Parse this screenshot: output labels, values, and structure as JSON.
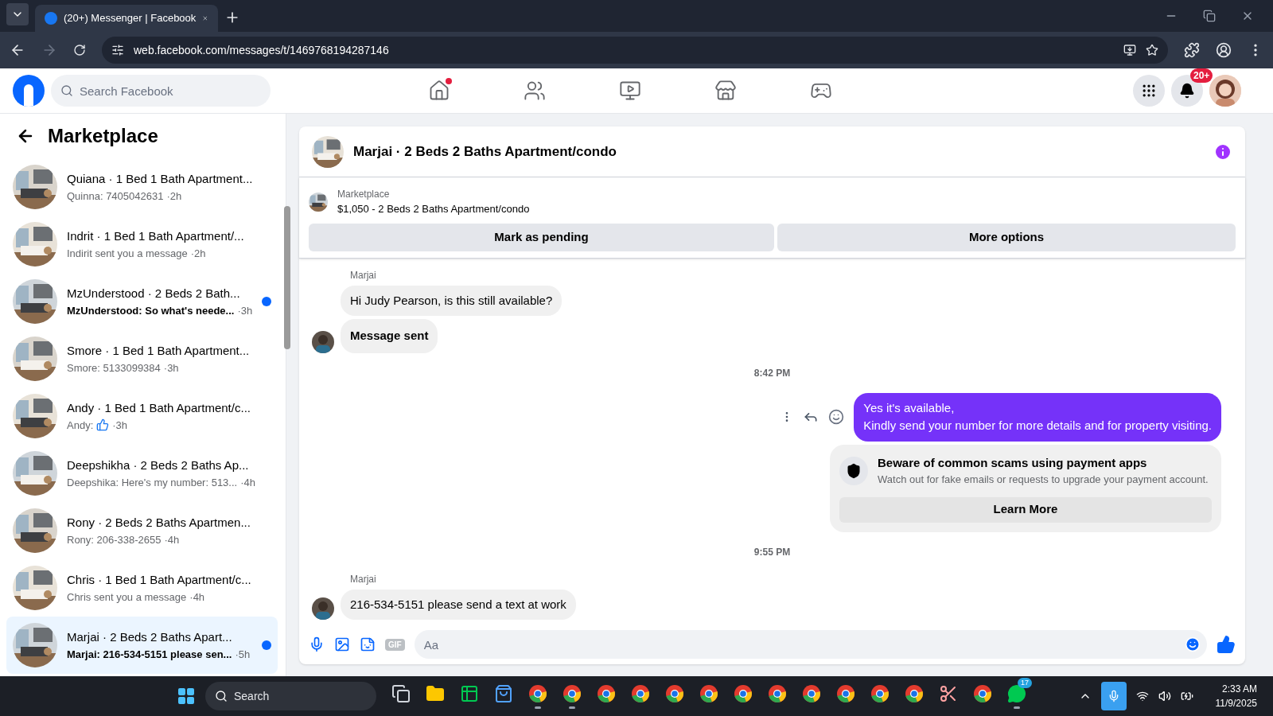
{
  "browser": {
    "tab_title": "(20+) Messenger | Facebook",
    "url": "web.facebook.com/messages/t/1469768194287146"
  },
  "topbar": {
    "search_placeholder": "Search Facebook",
    "nav": [
      {
        "kind": "home",
        "dot": true
      },
      {
        "kind": "friends",
        "dot": false
      },
      {
        "kind": "video",
        "dot": false
      },
      {
        "kind": "marketplace",
        "dot": false
      },
      {
        "kind": "gaming",
        "dot": false
      }
    ],
    "notifications_badge": "20+"
  },
  "sidebar": {
    "title": "Marketplace",
    "conversations": [
      {
        "title": "Quiana · 1 Bed 1 Bath Apartment...",
        "preview": "Quinna: 7405042631",
        "time": "·2h",
        "unread": false,
        "selected": false,
        "like": false
      },
      {
        "title": "Indrit · 1 Bed 1 Bath Apartment/...",
        "preview": "Indirit sent you a message",
        "time": "·2h",
        "unread": false,
        "selected": false,
        "like": false
      },
      {
        "title": "MzUnderstood · 2 Beds 2 Bath...",
        "preview": "MzUnderstood: So what's neede...",
        "time": "·3h",
        "unread": true,
        "selected": false,
        "like": false
      },
      {
        "title": "Smore · 1 Bed 1 Bath Apartment...",
        "preview": "Smore: 5133099384",
        "time": "·3h",
        "unread": false,
        "selected": false,
        "like": false
      },
      {
        "title": "Andy · 1 Bed 1 Bath Apartment/c...",
        "preview": "Andy:",
        "time": "·3h",
        "unread": false,
        "selected": false,
        "like": true
      },
      {
        "title": "Deepshikha · 2 Beds 2 Baths Ap...",
        "preview": "Deepshika: Here's my number: 513...",
        "time": "·4h",
        "unread": false,
        "selected": false,
        "like": false
      },
      {
        "title": "Rony · 2 Beds 2 Baths Apartmen...",
        "preview": "Rony: 206-338-2655",
        "time": "·4h",
        "unread": false,
        "selected": false,
        "like": false
      },
      {
        "title": "Chris · 1 Bed 1 Bath Apartment/c...",
        "preview": "Chris sent you a message",
        "time": "·4h",
        "unread": false,
        "selected": false,
        "like": false
      },
      {
        "title": "Marjai · 2 Beds 2 Baths Apart...",
        "preview": "Marjai: 216-534-5151 please sen...",
        "time": "·5h",
        "unread": true,
        "selected": true,
        "like": false
      }
    ]
  },
  "chat": {
    "title": "Marjai · 2 Beds 2 Baths Apartment/condo",
    "listing": {
      "label": "Marketplace",
      "name": "$1,050 - 2 Beds 2 Baths Apartment/condo"
    },
    "actions": [
      "Mark as pending",
      "More options"
    ],
    "messages": [
      {
        "kind": "sender",
        "text": "Marjai"
      },
      {
        "kind": "incoming",
        "text": "Hi Judy Pearson, is this still available?",
        "avatar": false,
        "bold": false
      },
      {
        "kind": "incoming",
        "text": "Message sent",
        "avatar": true,
        "bold": true
      },
      {
        "kind": "time",
        "text": "8:42 PM"
      },
      {
        "kind": "outgoing",
        "lines": [
          "Yes it's available,",
          "Kindly send your number for more details and for property visiting."
        ]
      },
      {
        "kind": "notice",
        "title": "Beware of common scams using payment apps",
        "body": "Watch out for fake emails or requests to upgrade your payment account.",
        "button": "Learn More"
      },
      {
        "kind": "time",
        "text": "9:55 PM"
      },
      {
        "kind": "sender",
        "text": "Marjai"
      },
      {
        "kind": "incoming",
        "text": "216-534-5151 please send a text at work",
        "avatar": true,
        "bold": false
      }
    ],
    "composer": {
      "gif": "GIF",
      "placeholder": "Aa"
    }
  },
  "taskbar": {
    "search": "Search",
    "apps": [
      {
        "kind": "taskview",
        "running": false
      },
      {
        "kind": "files",
        "running": false
      },
      {
        "kind": "sheets",
        "running": false
      },
      {
        "kind": "store",
        "running": false
      },
      {
        "kind": "chrome",
        "running": true
      },
      {
        "kind": "chrome",
        "running": true
      },
      {
        "kind": "chrome",
        "running": false
      },
      {
        "kind": "chrome",
        "running": false
      },
      {
        "kind": "chrome",
        "running": false
      },
      {
        "kind": "chrome",
        "running": false
      },
      {
        "kind": "chrome",
        "running": false
      },
      {
        "kind": "chrome",
        "running": false
      },
      {
        "kind": "chrome",
        "running": false
      },
      {
        "kind": "chrome",
        "running": false
      },
      {
        "kind": "chrome",
        "running": false
      },
      {
        "kind": "chrome",
        "running": false
      },
      {
        "kind": "snip",
        "running": false
      },
      {
        "kind": "chrome",
        "running": false
      },
      {
        "kind": "whatsapp",
        "running": true,
        "badge": "17"
      }
    ],
    "time": "2:33 AM",
    "date": "11/9/2025"
  }
}
